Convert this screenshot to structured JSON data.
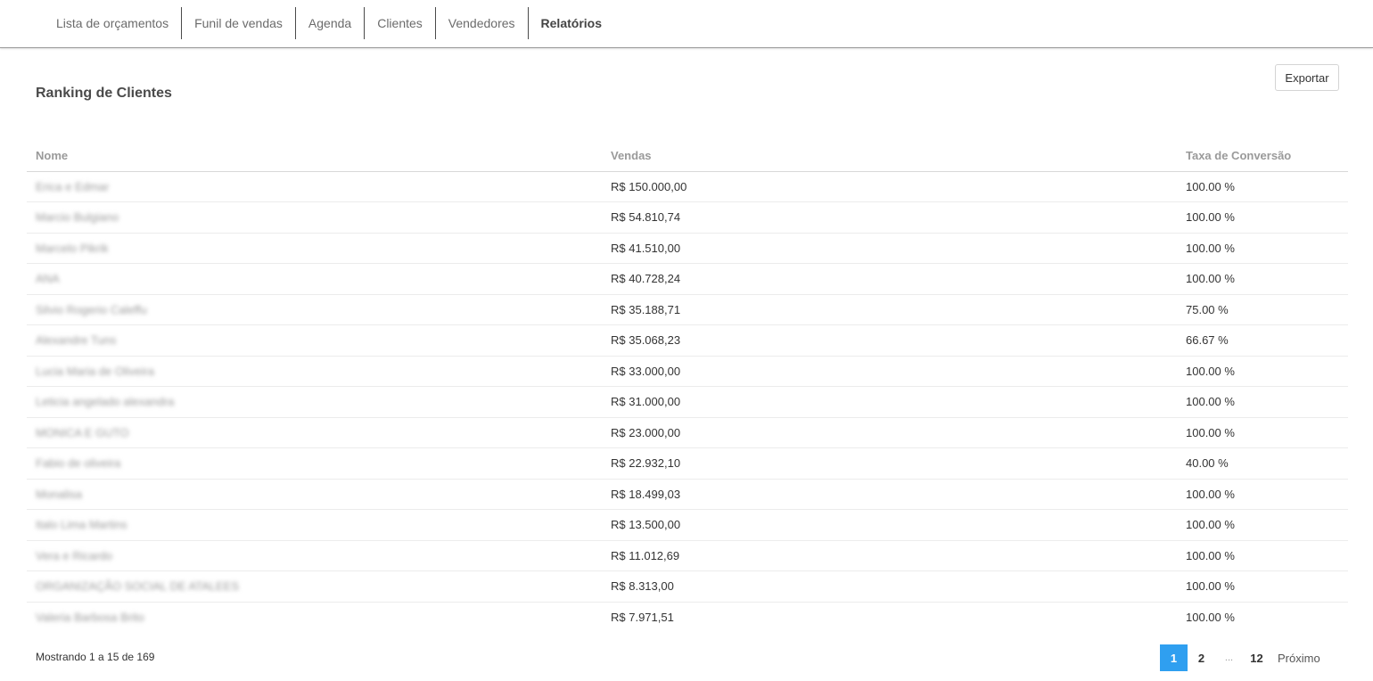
{
  "nav": {
    "tabs": [
      {
        "label": "Lista de orçamentos",
        "active": false
      },
      {
        "label": "Funil de vendas",
        "active": false
      },
      {
        "label": "Agenda",
        "active": false
      },
      {
        "label": "Clientes",
        "active": false
      },
      {
        "label": "Vendedores",
        "active": false
      },
      {
        "label": "Relatórios",
        "active": true
      }
    ]
  },
  "header": {
    "title": "Ranking de Clientes",
    "export_label": "Exportar"
  },
  "table": {
    "columns": [
      "Nome",
      "Vendas",
      "Taxa de Conversão"
    ],
    "rows": [
      {
        "nome": "Erica e Edmar",
        "vendas": "R$ 150.000,00",
        "taxa": "100.00 %"
      },
      {
        "nome": "Marcio Bulgiano",
        "vendas": "R$ 54.810,74",
        "taxa": "100.00 %"
      },
      {
        "nome": "Marcelo Pikrik",
        "vendas": "R$ 41.510,00",
        "taxa": "100.00 %"
      },
      {
        "nome": "ANA",
        "vendas": "R$ 40.728,24",
        "taxa": "100.00 %"
      },
      {
        "nome": "Silvio Rogerio Caleffu",
        "vendas": "R$ 35.188,71",
        "taxa": "75.00 %"
      },
      {
        "nome": "Alexandre Tuns",
        "vendas": "R$ 35.068,23",
        "taxa": "66.67 %"
      },
      {
        "nome": "Lucia Maria de Oliveira",
        "vendas": "R$ 33.000,00",
        "taxa": "100.00 %"
      },
      {
        "nome": "Leticia angelado alexandra",
        "vendas": "R$ 31.000,00",
        "taxa": "100.00 %"
      },
      {
        "nome": "MONICA E GUTO",
        "vendas": "R$ 23.000,00",
        "taxa": "100.00 %"
      },
      {
        "nome": "Fabio de oliveira",
        "vendas": "R$ 22.932,10",
        "taxa": "40.00 %"
      },
      {
        "nome": "Monalisa",
        "vendas": "R$ 18.499,03",
        "taxa": "100.00 %"
      },
      {
        "nome": "Italo Lima Martins",
        "vendas": "R$ 13.500,00",
        "taxa": "100.00 %"
      },
      {
        "nome": "Vera e Ricardo",
        "vendas": "R$ 11.012,69",
        "taxa": "100.00 %"
      },
      {
        "nome": "ORGANIZAÇÃO SOCIAL DE ATALEES",
        "vendas": "R$ 8.313,00",
        "taxa": "100.00 %"
      },
      {
        "nome": "Valeria Barbosa Brito",
        "vendas": "R$ 7.971,51",
        "taxa": "100.00 %"
      }
    ]
  },
  "footer": {
    "showing": "Mostrando 1 a 15 de 169",
    "pages": [
      "1",
      "2",
      "...",
      "12"
    ],
    "next_label": "Próximo"
  },
  "colors": {
    "accent": "#2f9ff0"
  }
}
